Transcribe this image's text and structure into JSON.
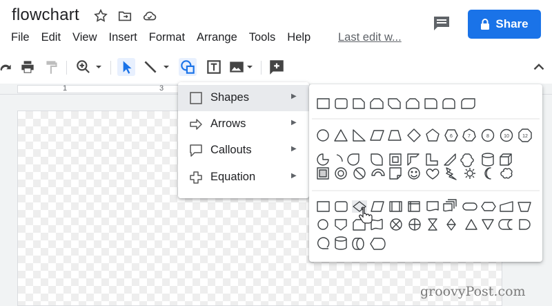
{
  "doc": {
    "title": "flowchart"
  },
  "share": {
    "label": "Share"
  },
  "menus": [
    "File",
    "Edit",
    "View",
    "Insert",
    "Format",
    "Arrange",
    "Tools",
    "Help"
  ],
  "last_edit": "Last edit w...",
  "ruler": {
    "nums": [
      "1",
      "3"
    ]
  },
  "shape_menu": {
    "items": [
      {
        "label": "Shapes",
        "icon": "square-icon"
      },
      {
        "label": "Arrows",
        "icon": "arrow-icon"
      },
      {
        "label": "Callouts",
        "icon": "callout-icon"
      },
      {
        "label": "Equation",
        "icon": "plus-icon"
      }
    ]
  },
  "colors": {
    "accent": "#1a73e8",
    "highlight": "#e8eaed"
  },
  "watermark": "groovyPost.com"
}
